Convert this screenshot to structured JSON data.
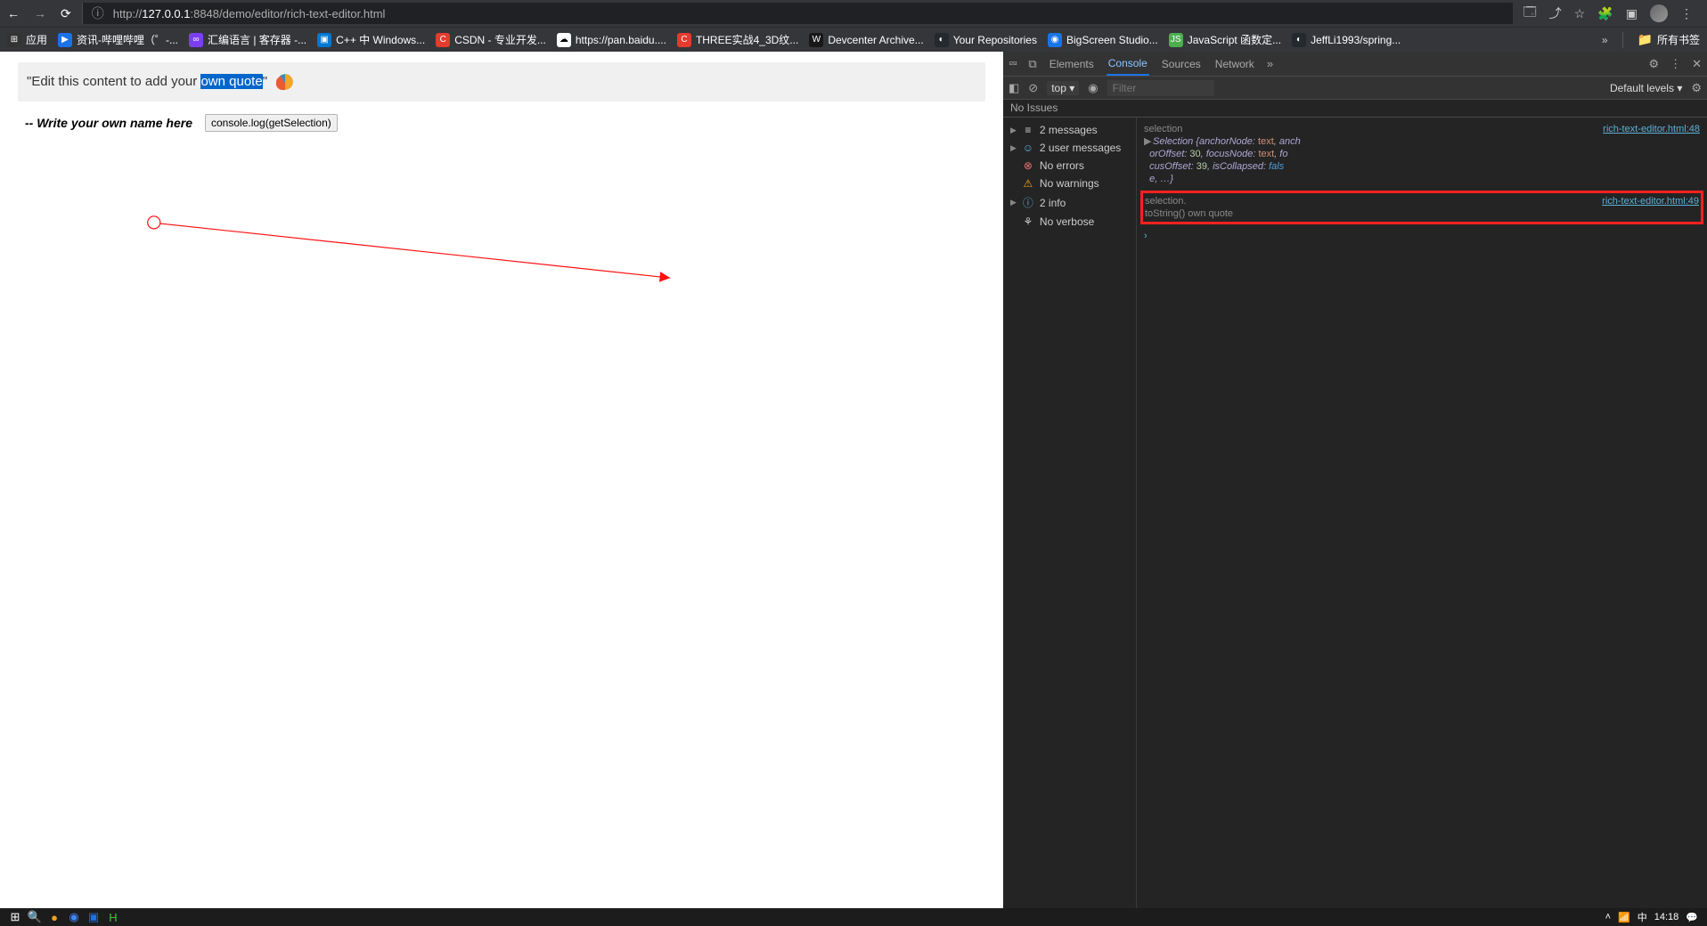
{
  "browser": {
    "url_prefix": "http://",
    "url_host": "127.0.0.1",
    "url_port": ":8848",
    "url_path": "/demo/editor/rich-text-editor.html"
  },
  "bookmarks": {
    "apps": "应用",
    "items": [
      "资讯-哔哩哔哩（゜-...",
      "汇编语言 | 客存器 -...",
      "C++ 中 Windows...",
      "CSDN - 专业开发...",
      "https://pan.baidu....",
      "THREE实战4_3D纹...",
      "Devcenter Archive...",
      "Your Repositories",
      "BigScreen Studio...",
      "JavaScript 函数定...",
      "JeffLi1993/spring..."
    ],
    "all_bookmarks": "所有书签"
  },
  "page": {
    "quote_prefix": "\"Edit this content to add your ",
    "quote_selected": "own quote",
    "quote_suffix": "\"",
    "subtitle": "-- Write your own name here",
    "button_label": "console.log(getSelection)"
  },
  "devtools": {
    "tabs": [
      "Elements",
      "Console",
      "Sources",
      "Network"
    ],
    "active_tab": "Console",
    "context": "top",
    "filter_placeholder": "Filter",
    "levels": "Default levels",
    "issues": "No Issues",
    "filter_rows": {
      "messages": "2 messages",
      "user_messages": "2 user messages",
      "no_errors": "No errors",
      "no_warnings": "No warnings",
      "info": "2 info",
      "no_verbose": "No verbose"
    },
    "log1": {
      "label": "selection",
      "src": "rich-text-editor.html:48",
      "l1_a": "Selection {",
      "l1_b": "anchorNode:",
      "l1_c": "text",
      "l1_d": ", anch",
      "l2_a": "orOffset:",
      "l2_b": "30",
      "l2_c": ", focusNode:",
      "l2_d": "text",
      "l2_e": ", fo",
      "l3_a": "cusOffset:",
      "l3_b": "39",
      "l3_c": ", isCollapsed:",
      "l3_d": "fals",
      "l4": "e, …}"
    },
    "log2": {
      "l1_a": "selection.",
      "src": "rich-text-editor.html:49",
      "l2": "toString() own quote"
    }
  },
  "taskbar": {
    "ime": "中",
    "time": "14:18"
  }
}
